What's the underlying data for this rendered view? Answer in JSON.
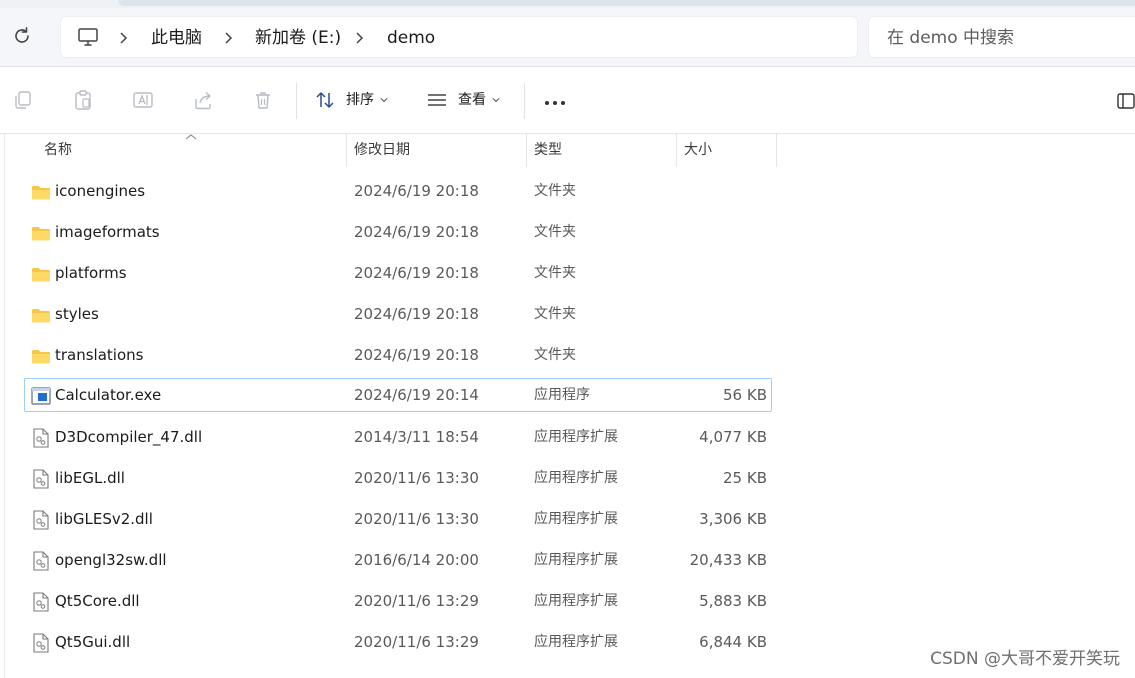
{
  "address_bar": {
    "breadcrumbs": [
      "此电脑",
      "新加卷 (E:)",
      "demo"
    ],
    "search_placeholder": "在 demo 中搜索"
  },
  "toolbar": {
    "sort_label": "排序",
    "view_label": "查看",
    "actions": [
      "copy-icon",
      "paste-icon",
      "rename-icon",
      "share-icon",
      "delete-icon"
    ]
  },
  "columns": {
    "name": "名称",
    "date": "修改日期",
    "type": "类型",
    "size": "大小",
    "sorted_by": "name"
  },
  "files": [
    {
      "name": "iconengines",
      "date": "2024/6/19 20:18",
      "type": "文件夹",
      "size": "",
      "icon": "folder-icon",
      "selected": false
    },
    {
      "name": "imageformats",
      "date": "2024/6/19 20:18",
      "type": "文件夹",
      "size": "",
      "icon": "folder-icon",
      "selected": false
    },
    {
      "name": "platforms",
      "date": "2024/6/19 20:18",
      "type": "文件夹",
      "size": "",
      "icon": "folder-icon",
      "selected": false
    },
    {
      "name": "styles",
      "date": "2024/6/19 20:18",
      "type": "文件夹",
      "size": "",
      "icon": "folder-icon",
      "selected": false
    },
    {
      "name": "translations",
      "date": "2024/6/19 20:18",
      "type": "文件夹",
      "size": "",
      "icon": "folder-icon",
      "selected": false
    },
    {
      "name": "Calculator.exe",
      "date": "2024/6/19 20:14",
      "type": "应用程序",
      "size": "56 KB",
      "icon": "exe-icon",
      "selected": true
    },
    {
      "name": "D3Dcompiler_47.dll",
      "date": "2014/3/11 18:54",
      "type": "应用程序扩展",
      "size": "4,077 KB",
      "icon": "dll-icon",
      "selected": false
    },
    {
      "name": "libEGL.dll",
      "date": "2020/11/6 13:30",
      "type": "应用程序扩展",
      "size": "25 KB",
      "icon": "dll-icon",
      "selected": false
    },
    {
      "name": "libGLESv2.dll",
      "date": "2020/11/6 13:30",
      "type": "应用程序扩展",
      "size": "3,306 KB",
      "icon": "dll-icon",
      "selected": false
    },
    {
      "name": "opengl32sw.dll",
      "date": "2016/6/14 20:00",
      "type": "应用程序扩展",
      "size": "20,433 KB",
      "icon": "dll-icon",
      "selected": false
    },
    {
      "name": "Qt5Core.dll",
      "date": "2020/11/6 13:29",
      "type": "应用程序扩展",
      "size": "5,883 KB",
      "icon": "dll-icon",
      "selected": false
    },
    {
      "name": "Qt5Gui.dll",
      "date": "2020/11/6 13:29",
      "type": "应用程序扩展",
      "size": "6,844 KB",
      "icon": "dll-icon",
      "selected": false
    }
  ],
  "watermark": "CSDN @大哥不爱开笑玩",
  "colors": {
    "folder": "#f8c646",
    "selection_border": "#9fcff4",
    "exe_blue": "#1f6fd1"
  }
}
